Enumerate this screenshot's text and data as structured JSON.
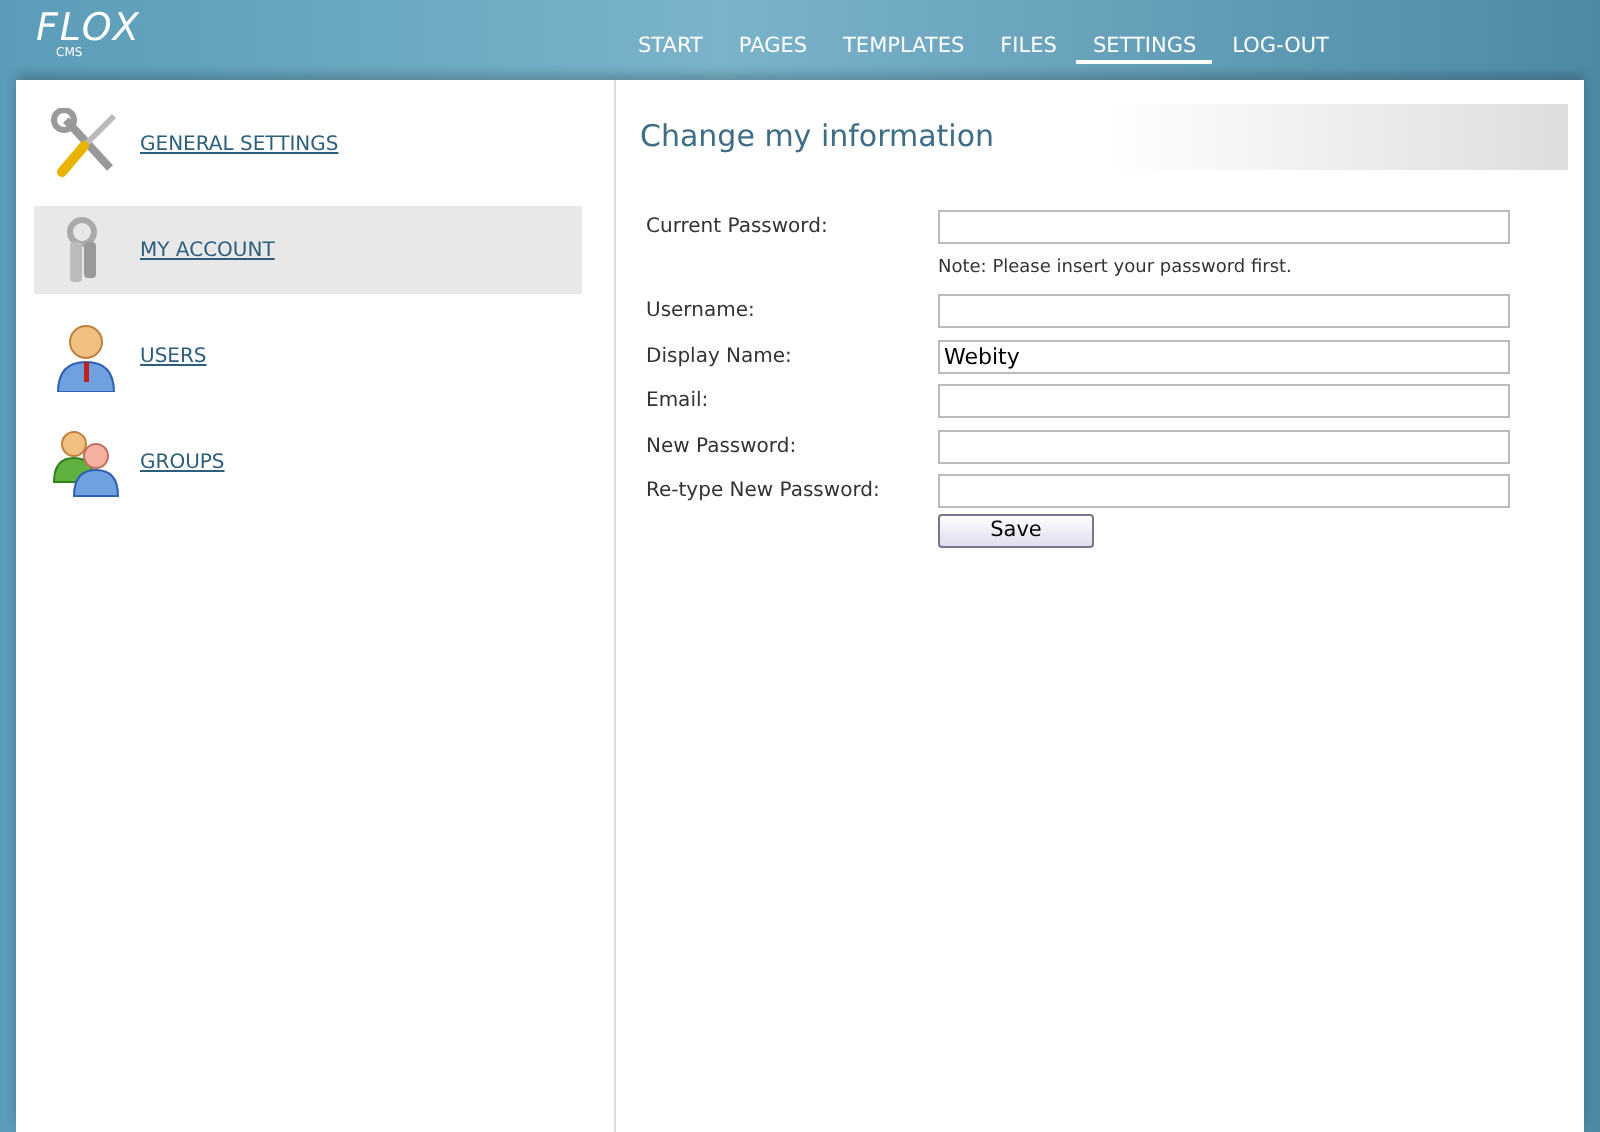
{
  "logo": {
    "title": "FLOX",
    "subtitle": "CMS"
  },
  "nav": [
    {
      "label": "START",
      "selected": false
    },
    {
      "label": "PAGES",
      "selected": false
    },
    {
      "label": "TEMPLATES",
      "selected": false
    },
    {
      "label": "FILES",
      "selected": false
    },
    {
      "label": "SETTINGS",
      "selected": true
    },
    {
      "label": "LOG-OUT",
      "selected": false
    }
  ],
  "sidebar": {
    "items": [
      {
        "label": "GENERAL SETTINGS",
        "kind": "tools",
        "selected": false
      },
      {
        "label": "MY ACCOUNT",
        "kind": "keys",
        "selected": true
      },
      {
        "label": "USERS",
        "kind": "user",
        "selected": false
      },
      {
        "label": "GROUPS",
        "kind": "group",
        "selected": false
      }
    ]
  },
  "form": {
    "title": "Change my information",
    "rows": [
      {
        "kind": "field",
        "label": "Current Password:",
        "value": ""
      },
      {
        "kind": "note",
        "text": "Note: Please insert your password first."
      },
      {
        "kind": "field",
        "label": "Username:",
        "value": ""
      },
      {
        "kind": "field",
        "label": "Display Name:",
        "value": "Webity"
      },
      {
        "kind": "field",
        "label": "Email:",
        "value": ""
      },
      {
        "kind": "field",
        "label": "New Password:",
        "value": ""
      },
      {
        "kind": "field",
        "label": "Re-type New Password:",
        "value": ""
      }
    ],
    "button": "Save"
  }
}
